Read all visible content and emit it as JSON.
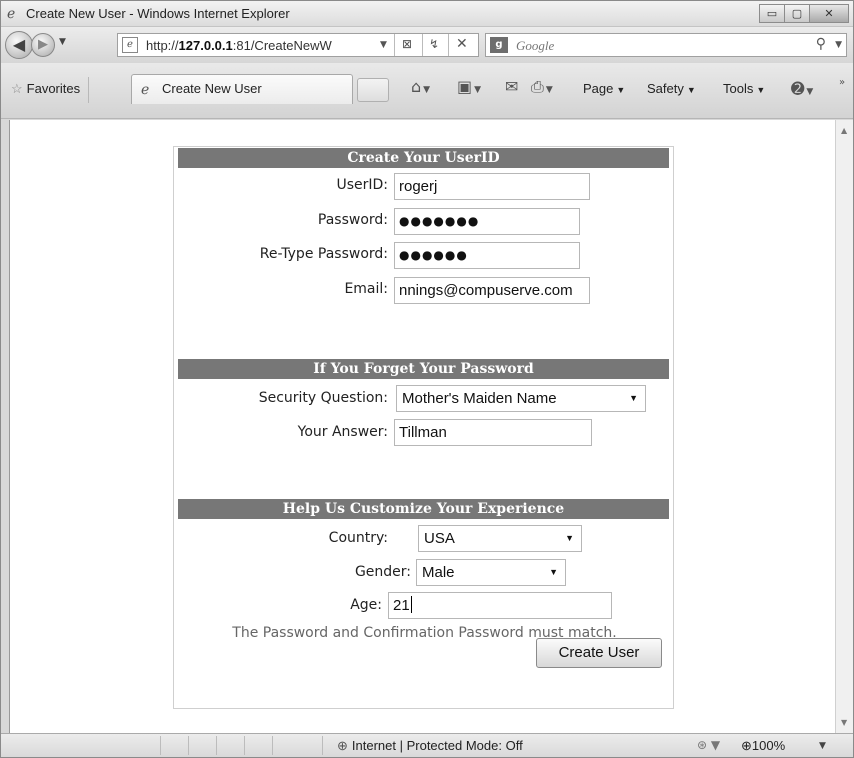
{
  "window": {
    "title": "Create New User - Windows Internet Explorer",
    "buttons": {
      "minimize": "▭",
      "maximize": "▢",
      "close": "✕"
    }
  },
  "address_bar": {
    "url_prefix": "http://",
    "url_host": "127.0.0.1",
    "url_rest": ":81/CreateNewW",
    "search_provider": "Google"
  },
  "favorites_bar": {
    "favorites_label": "Favorites",
    "tab_title": "Create New User",
    "commands": {
      "page": "Page",
      "safety": "Safety",
      "tools": "Tools"
    }
  },
  "form": {
    "section1": {
      "heading": "Create Your UserID",
      "userid_label": "UserID:",
      "userid_value": "rogerj",
      "password_label": "Password:",
      "password_value": "●●●●●●●",
      "retype_label": "Re-Type Password:",
      "retype_value": "●●●●●●",
      "email_label": "Email:",
      "email_value": "nnings@compuserve.com"
    },
    "section2": {
      "heading": "If You Forget Your Password",
      "question_label": "Security Question:",
      "question_value": "Mother's Maiden Name",
      "answer_label": "Your Answer:",
      "answer_value": "Tillman"
    },
    "section3": {
      "heading": "Help Us Customize Your Experience",
      "country_label": "Country:",
      "country_value": "USA",
      "gender_label": "Gender:",
      "gender_value": "Male",
      "age_label": "Age:",
      "age_value": "21"
    },
    "error_message": "The Password and Confirmation Password must match.",
    "submit_label": "Create User"
  },
  "status_bar": {
    "zone": "Internet | Protected Mode: Off",
    "zoom": "100%"
  },
  "icons": [
    "ie-icon",
    "back-arrow-icon",
    "forward-arrow-icon",
    "page-icon",
    "compat-view-icon",
    "refresh-icon",
    "stop-icon",
    "google-icon",
    "search-icon",
    "star-icon",
    "home-icon",
    "feeds-icon",
    "read-mail-icon",
    "print-icon",
    "help-icon",
    "globe-icon",
    "security-icon",
    "zoom-icon"
  ]
}
